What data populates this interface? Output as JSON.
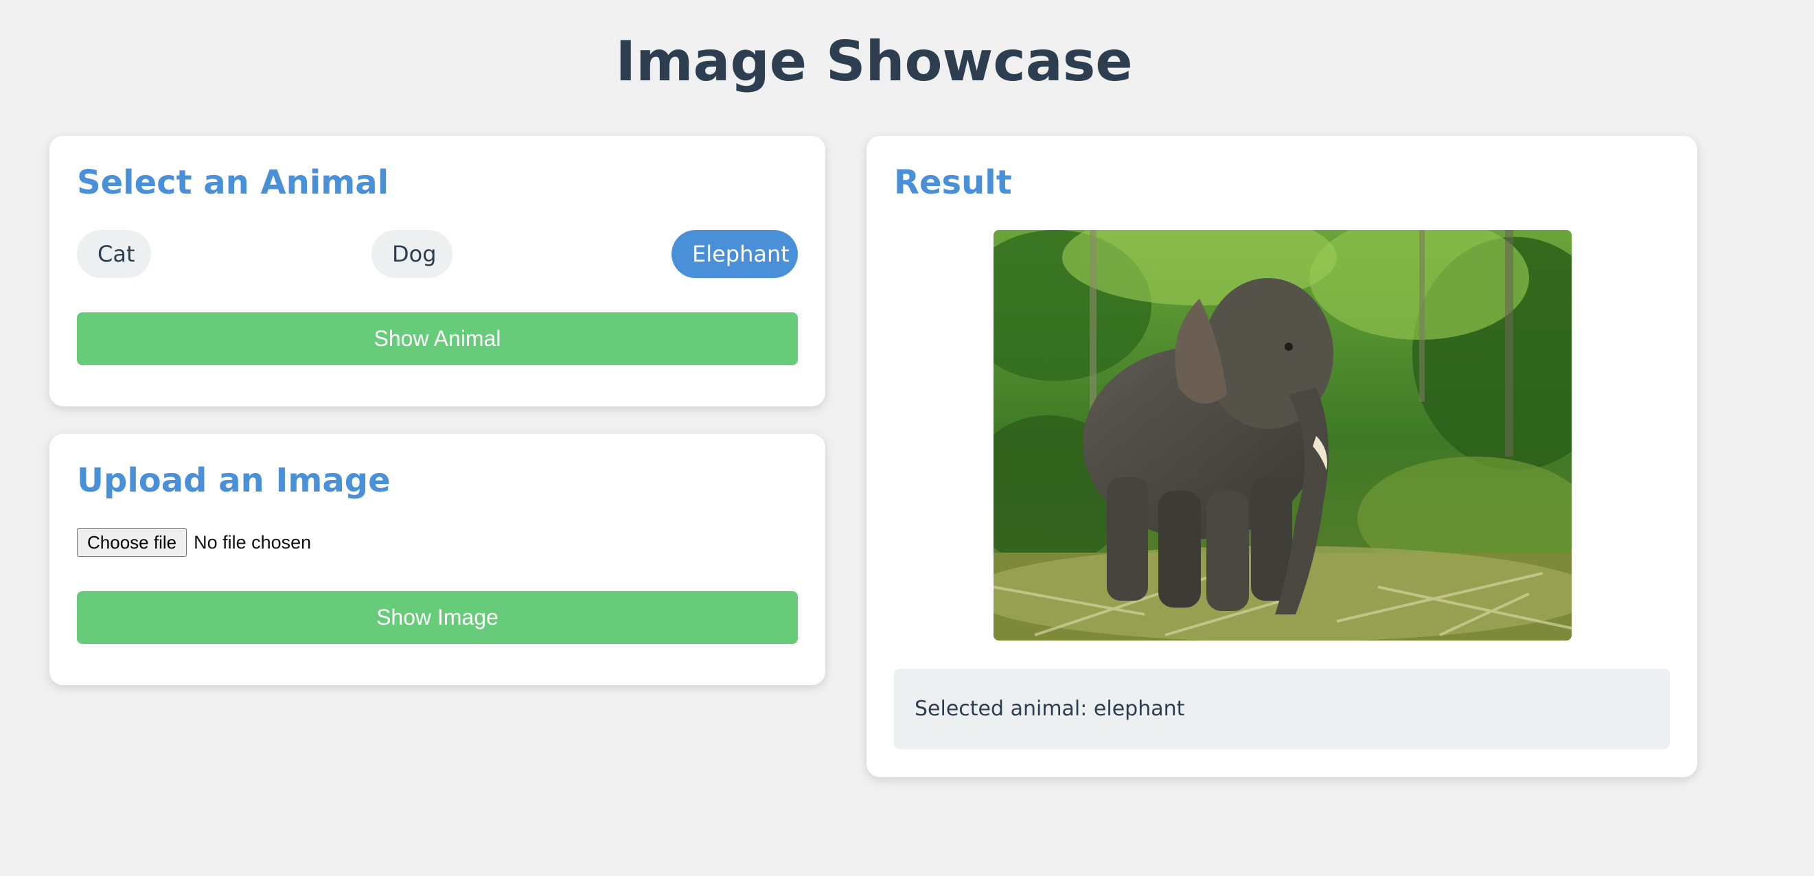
{
  "page": {
    "title": "Image Showcase"
  },
  "select_card": {
    "heading": "Select an Animal",
    "options": [
      {
        "label": "Cat",
        "selected": false
      },
      {
        "label": "Dog",
        "selected": false
      },
      {
        "label": "Elephant",
        "selected": true
      }
    ],
    "button_label": "Show Animal"
  },
  "upload_card": {
    "heading": "Upload an Image",
    "file_button_label": "Choose file",
    "file_status": "No file chosen",
    "button_label": "Show Image"
  },
  "result_card": {
    "heading": "Result",
    "image_subject": "elephant-in-jungle",
    "result_text": "Selected animal: elephant"
  },
  "colors": {
    "title": "#2c3e50",
    "heading_accent": "#4a90d9",
    "active_pill": "#4a90d9",
    "pill_bg": "#ecf0f1",
    "primary_button": "#66cc7a",
    "page_bg": "#f0f0f0"
  }
}
